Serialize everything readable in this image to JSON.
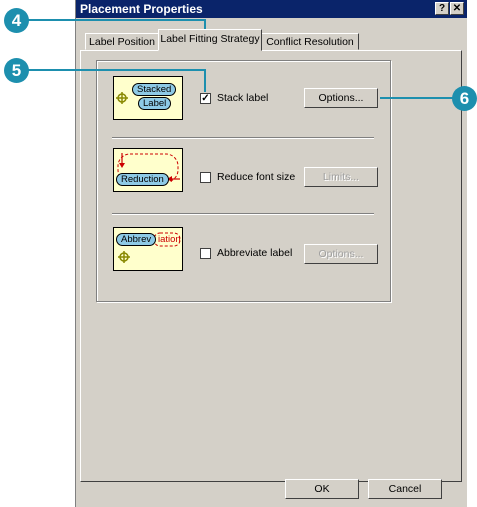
{
  "dialog": {
    "title": "Placement Properties",
    "help_button": "?",
    "close_button": "✕"
  },
  "tabs": [
    {
      "label": "Label Position",
      "active": false
    },
    {
      "label": "Label Fitting Strategy",
      "active": true
    },
    {
      "label": "Conflict Resolution",
      "active": false
    }
  ],
  "strategies": {
    "stack": {
      "label": "Stack label",
      "checked": true,
      "button": "Options...",
      "button_enabled": true,
      "preview_words": [
        "Stacked",
        "Label"
      ]
    },
    "reduce": {
      "label": "Reduce font size",
      "checked": false,
      "button": "Limits...",
      "button_enabled": false,
      "preview_word": "Reduction"
    },
    "abbreviate": {
      "label": "Abbreviate label",
      "checked": false,
      "button": "Options...",
      "button_enabled": false,
      "preview_word_a": "Abbrev",
      "preview_word_b": "iation"
    }
  },
  "footer": {
    "ok": "OK",
    "cancel": "Cancel"
  },
  "callouts": [
    "4",
    "5",
    "6"
  ],
  "colors": {
    "titlebar": "#0a246a",
    "dialog_bg": "#d4d0c8",
    "callout": "#1d8fae",
    "preview_bg": "#ffffcc",
    "preview_label": "#8ecae6",
    "arrow_red": "#cc0000"
  }
}
